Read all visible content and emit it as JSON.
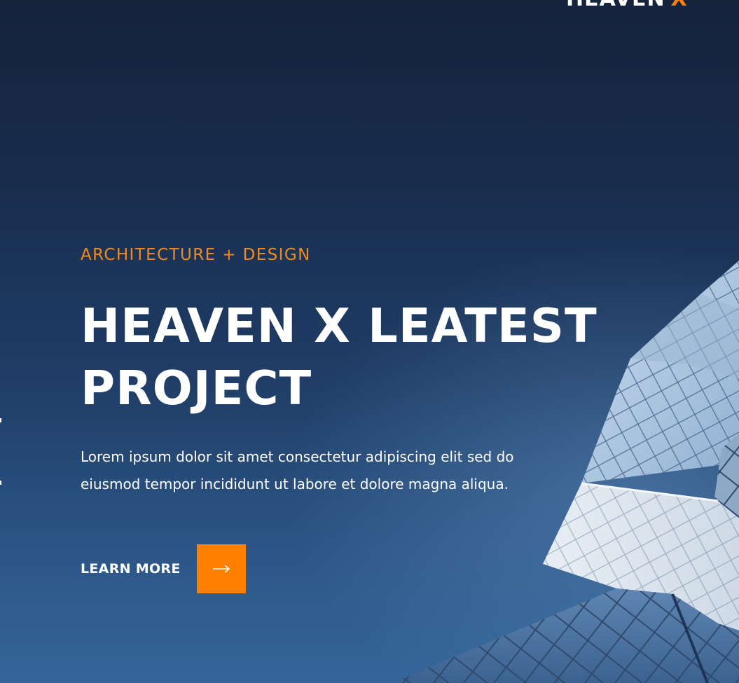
{
  "logo": {
    "name": "HEAVEN",
    "mark": "X"
  },
  "hero": {
    "eyebrow": "ARCHITECTURE + DESIGN",
    "title_line_1": "HEAVEN X LEATEST",
    "title_line_2": "PROJECT",
    "description_line_1": "Lorem ipsum dolor sit amet consectetur adipiscing elit sed do",
    "description_line_2": "eiusmod tempor incididunt ut labore et dolore magna aliqua.",
    "cta_label": "LEARN MORE",
    "cta_icon": "arrow-right-icon"
  },
  "colors": {
    "accent": "#ff8000",
    "background": "#1a2e4f",
    "text": "#ffffff"
  }
}
